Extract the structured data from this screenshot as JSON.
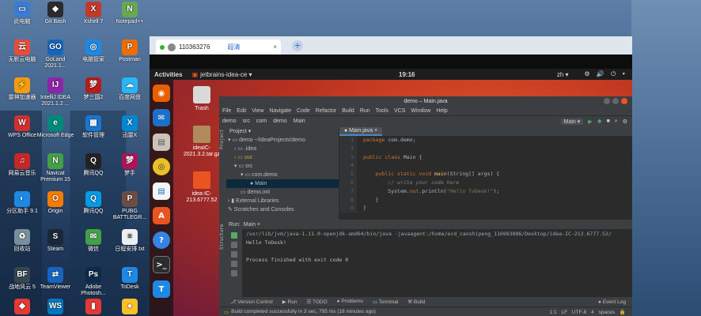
{
  "desktop": {
    "icons": [
      {
        "label": "此电脑",
        "color": "#3a7bd5",
        "glyph": "▭"
      },
      {
        "label": "Git Bash",
        "color": "#2b2b2b",
        "glyph": "◆"
      },
      {
        "label": "Xshell 7",
        "color": "#c0392b",
        "glyph": "X"
      },
      {
        "label": "Notepad++",
        "color": "#6aa84f",
        "glyph": "N"
      },
      {
        "label": "无影云电脑",
        "color": "#e74c3c",
        "glyph": "云"
      },
      {
        "label": "GoLand 2021.1...",
        "color": "#1565c0",
        "glyph": "GO"
      },
      {
        "label": "电脑管家",
        "color": "#1e88e5",
        "glyph": "◎"
      },
      {
        "label": "Postman",
        "color": "#ef6c00",
        "glyph": "P"
      },
      {
        "label": "雷神加速器",
        "color": "#f39c12",
        "glyph": "⚡"
      },
      {
        "label": "IntelliJ IDEA 2021.1.2 ...",
        "color": "#8e24aa",
        "glyph": "IJ"
      },
      {
        "label": "梦三国2",
        "color": "#b71c1c",
        "glyph": "梦"
      },
      {
        "label": "百度网盘",
        "color": "#29b6f6",
        "glyph": "☁"
      },
      {
        "label": "WPS Office",
        "color": "#d32f2f",
        "glyph": "W"
      },
      {
        "label": "Microsoft Edge",
        "color": "#00897b",
        "glyph": "e"
      },
      {
        "label": "软件管理",
        "color": "#1976d2",
        "glyph": "▦"
      },
      {
        "label": "迅雷X",
        "color": "#0288d1",
        "glyph": "X"
      },
      {
        "label": "网易云音乐",
        "color": "#c62828",
        "glyph": "♫"
      },
      {
        "label": "Navicat Premium 15",
        "color": "#43a047",
        "glyph": "N"
      },
      {
        "label": "腾讯QQ",
        "color": "#222222",
        "glyph": "Q"
      },
      {
        "label": "梦手",
        "color": "#ad1457",
        "glyph": "梦"
      },
      {
        "label": "分区助手 9.1",
        "color": "#1e88e5",
        "glyph": "◐"
      },
      {
        "label": "Origin",
        "color": "#f57c00",
        "glyph": "O"
      },
      {
        "label": "腾讯QQ",
        "color": "#039be5",
        "glyph": "Q"
      },
      {
        "label": "PUBG BATTLEGR...",
        "color": "#6d4c41",
        "glyph": "P"
      },
      {
        "label": "回收站",
        "color": "#78909c",
        "glyph": "♻"
      },
      {
        "label": "Steam",
        "color": "#1b2838",
        "glyph": "S"
      },
      {
        "label": "微信",
        "color": "#43a047",
        "glyph": "✉"
      },
      {
        "label": "日程安排.txt",
        "color": "#eceff1",
        "glyph": "≡"
      },
      {
        "label": "战地风云 5",
        "color": "#37474f",
        "glyph": "BF"
      },
      {
        "label": "TeamViewer",
        "color": "#1565c0",
        "glyph": "⇄"
      },
      {
        "label": "Adobe Photosh...",
        "color": "#0d2a4a",
        "glyph": "Ps"
      },
      {
        "label": "ToDesk",
        "color": "#1e88e5",
        "glyph": "T"
      },
      {
        "label": "",
        "color": "#e53935",
        "glyph": "◆"
      },
      {
        "label": "",
        "color": "#0277bd",
        "glyph": "WS"
      },
      {
        "label": "",
        "color": "#e53935",
        "glyph": "▮"
      },
      {
        "label": "",
        "color": "#fbc02d",
        "glyph": "●"
      }
    ]
  },
  "todesk": {
    "tab_id": "110363276",
    "tab_name": "超清",
    "tab_close": "×",
    "new_tab": "+"
  },
  "ubuntu": {
    "activities": "Activities",
    "app_name": "jetbrains-idea-ce ▾",
    "clock": "19:16",
    "lang": "zh ▾",
    "tray": "⚙ 🔊 ⏻ ▾",
    "files": [
      {
        "label": "Trash"
      },
      {
        "label": "ideaIC-2021.3.2.tar.gz"
      },
      {
        "label": "idea-IC-213.6777.52"
      }
    ]
  },
  "ide": {
    "title": "demo – Main.java",
    "menu": [
      "File",
      "Edit",
      "View",
      "Navigate",
      "Code",
      "Refactor",
      "Build",
      "Run",
      "Tools",
      "VCS",
      "Window",
      "Help"
    ],
    "breadcrumb": [
      "demo",
      "src",
      "com",
      "demo",
      "Main"
    ],
    "run_config": "Main ▾",
    "project_label": "Project ▾",
    "project_stripe": "Project",
    "tree": [
      {
        "text": "▾ ▭ demo ~/IdeaProjects/demo",
        "indent": 2,
        "sel": false
      },
      {
        "text": "› ▭ .idea",
        "indent": 10,
        "sel": false
      },
      {
        "text": "› ▭ out",
        "indent": 10,
        "sel": false,
        "fold": true
      },
      {
        "text": "▾ ▭ src",
        "indent": 10,
        "sel": false
      },
      {
        "text": "▾ ▭ com.demo",
        "indent": 18,
        "sel": false
      },
      {
        "text": "● Main",
        "indent": 30,
        "sel": true
      },
      {
        "text": "▭ demo.iml",
        "indent": 18,
        "sel": false
      },
      {
        "text": "› ▮ External Libraries",
        "indent": 2,
        "sel": false
      },
      {
        "text": "  ✎ Scratches and Consoles",
        "indent": 2,
        "sel": false
      }
    ],
    "editor_tab": "● Main.java ×",
    "code_line_numbers": [
      "1",
      "2",
      "3",
      "4",
      "5",
      "6",
      "7",
      "8",
      "9"
    ],
    "code": {
      "l1a": "package",
      "l1b": " com.demo;",
      "l3a": "public class",
      "l3b": " Main {",
      "l5a": "    public static void ",
      "l5b": "main",
      "l5c": "(String[] args) {",
      "l6": "        // write your code here",
      "l7a": "        System.",
      "l7b": "out",
      "l7c": ".println(",
      "l7d": "\"Hello ToDesk!\"",
      "l7e": ");",
      "l8": "    }",
      "l9": "}"
    },
    "run_label": "Run:",
    "run_tab": "Main ×",
    "run_output": {
      "cmd": "/usr/lib/jvm/java-1.11.0-openjdk-amd64/bin/java -javaagent:/home/ecd_caoshipeng_116983886/Desktop/idea-IC-213.6777.52/",
      "line1": "Hello ToDesk!",
      "line2": "Process finished with exit code 0"
    },
    "side_labels": {
      "structure": "Structure",
      "bookmarks": "Bookmarks"
    },
    "bottom_tabs": [
      "⎇ Version Control",
      "▶ Run",
      "☰ TODO",
      "● Problems",
      "▭ Terminal",
      "⚒ Build"
    ],
    "event_log": "● Event Log",
    "status": {
      "message": "Build completed successfully in 3 sec, 795 ms (18 minutes ago)",
      "right": "1:1  LF  UTF-8  4 spaces  🔒"
    }
  }
}
